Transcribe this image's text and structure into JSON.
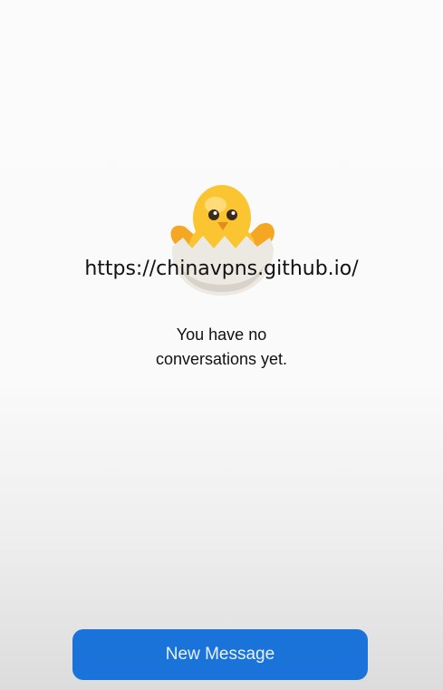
{
  "watermark": "https://chinavpns.github.io/",
  "empty_state": {
    "line1": "You have no",
    "line2": "conversations yet.",
    "illustration_icon": "hatching-chick-icon"
  },
  "actions": {
    "new_message_label": "New Message"
  },
  "colors": {
    "primary_button": "#1a73d9",
    "button_text": "#e9f1ff",
    "text": "#111111"
  }
}
